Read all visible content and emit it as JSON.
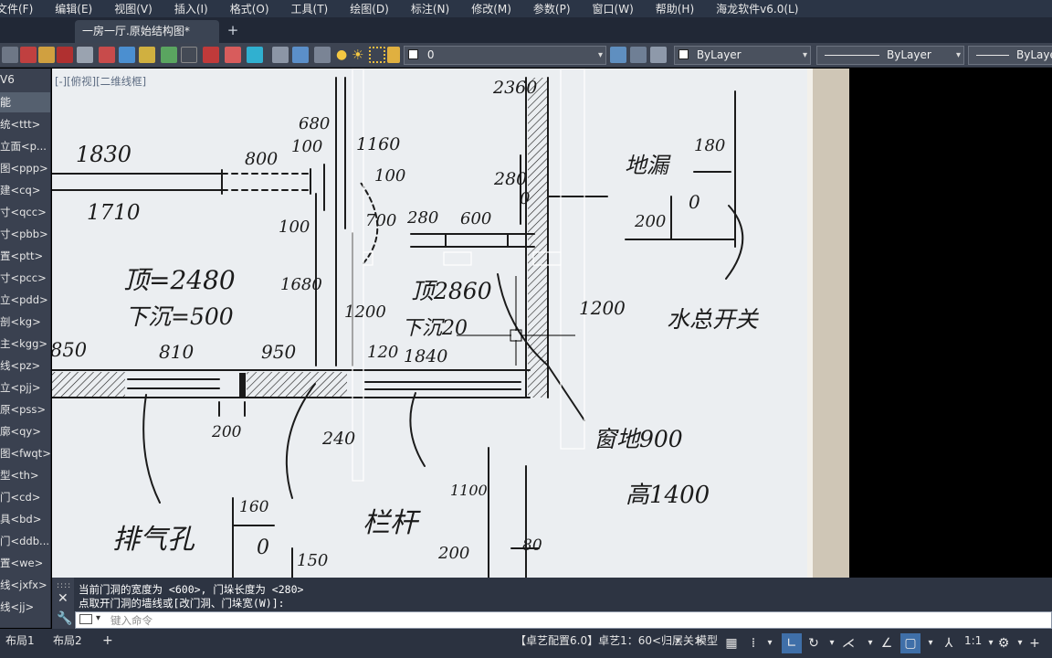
{
  "menu": [
    "文件(F)",
    "编辑(E)",
    "视图(V)",
    "插入(I)",
    "格式(O)",
    "工具(T)",
    "绘图(D)",
    "标注(N)",
    "修改(M)",
    "参数(P)",
    "窗口(W)",
    "帮助(H)",
    "海龙软件v6.0(L)"
  ],
  "tabs": {
    "active": "一房一厅.原始结构图*",
    "add": "+"
  },
  "toolbar": {
    "layer": "0",
    "color": "ByLayer",
    "linetype": "ByLayer",
    "lineweight": "ByLayer"
  },
  "left_panel": {
    "title": "V6",
    "active": "能",
    "items": [
      "统<ttt>",
      "立面<p...",
      "图<ppp>",
      "建<cq>",
      "寸<qcc>",
      "寸<pbb>",
      "置<ptt>",
      "寸<pcc>",
      "立<pdd>",
      "剖<kg>",
      "主<kgg>",
      "线<pz>",
      "立<pjj>",
      "原<pss>",
      "廓<qy>",
      "图<fwqt>",
      "型<th>",
      "门<cd>",
      "具<bd>",
      "门<ddb...",
      "置<we>",
      "线<jxfx>",
      "线<jj>"
    ]
  },
  "viewport_label": "[-][俯视][二维线框]",
  "drawing_text": {
    "d2360": "2360",
    "d1830": "1830",
    "d800": "800",
    "d680": "680",
    "d100a": "100",
    "d1160": "1160",
    "d100b": "100",
    "d1710": "1710",
    "d100c": "100",
    "d280a": "280",
    "d700": "700",
    "d280b": "280",
    "d600": "600",
    "floor_drain": "地漏",
    "d180": "180",
    "d200a": "200",
    "zero_a": "0",
    "zero_b": "0",
    "ceiling_2480": "顶=2480",
    "sunk_500": "下沉=500",
    "d1680": "1680",
    "ceiling_2860": "顶2860",
    "sunk_20": "下沉20",
    "d1200a": "1200",
    "d1200b": "1200",
    "water_switch": "水总开关",
    "d850": "850",
    "d810": "810",
    "d950": "950",
    "d120": "120",
    "d1840": "1840",
    "window_sill": "窗地900",
    "height_1400": "高1400",
    "d200b": "200",
    "d240": "240",
    "vent": "排气孔",
    "d160": "160",
    "zero_c": "0",
    "d150": "150",
    "railing": "栏杆",
    "d1100": "1100",
    "d200c": "200",
    "d80": "80"
  },
  "command": {
    "line1": "当前门洞的宽度为 <600>, 门垛长度为 <280>",
    "line2": "点取开门洞的墙线或[改门洞、门垛宽(W)]:",
    "placeholder": "键入命令"
  },
  "statusbar": {
    "layouts": [
      "布局1",
      "布局2"
    ],
    "add": "+",
    "config": "【卓艺配置6.0】卓艺1：60<归层关>",
    "model": "模型",
    "scale": "1:1"
  },
  "colors": {
    "menubar": "#2b3546",
    "toolbar": "#3d4452",
    "paper": "#ebeef1",
    "ink": "#1b1b1b",
    "crosshair": "#000000"
  }
}
